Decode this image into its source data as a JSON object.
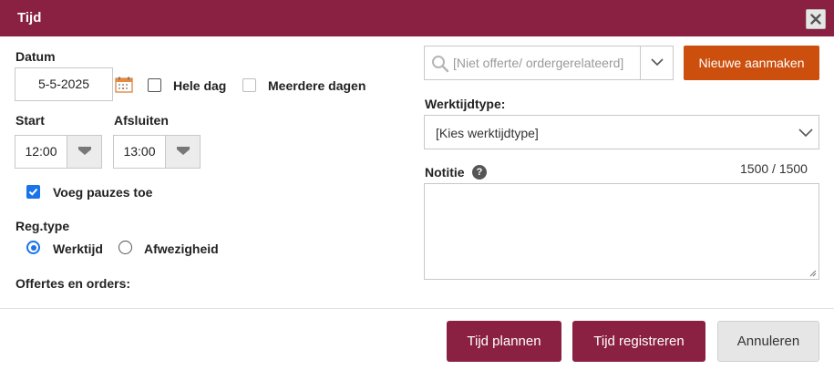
{
  "dialog": {
    "title": "Tijd",
    "close_icon": "close-icon"
  },
  "left": {
    "datum_label": "Datum",
    "date_value": "5-5-2025",
    "calendar_icon": "calendar-icon",
    "hele_dag_label": "Hele dag",
    "hele_dag_checked": false,
    "meerdere_dagen_label": "Meerdere dagen",
    "meerdere_dagen_checked": false,
    "meerdere_dagen_disabled": true,
    "start_label": "Start",
    "start_value": "12:00",
    "afsluiten_label": "Afsluiten",
    "afsluiten_value": "13:00",
    "pauzes_label": "Voeg pauzes toe",
    "pauzes_checked": true,
    "regtype_label": "Reg.type",
    "regtype_options": [
      "Werktijd",
      "Afwezigheid"
    ],
    "regtype_selected": "Werktijd",
    "offertes_label": "Offertes en orders:"
  },
  "right": {
    "search_placeholder": "[Niet offerte/ ordergerelateerd]",
    "search_icon": "search-icon",
    "new_button_label": "Nieuwe aanmaken",
    "werktijdtype_label": "Werktijdtype:",
    "werktijdtype_value": "[Kies werktijdtype]",
    "notitie_label": "Notitie",
    "help_icon": "help-icon",
    "counter": "1500 / 1500"
  },
  "footer": {
    "plan_label": "Tijd plannen",
    "register_label": "Tijd registreren",
    "cancel_label": "Annuleren"
  },
  "colors": {
    "brand": "#8a2042",
    "accent_orange": "#cc4f0d",
    "check_blue": "#1a73e8"
  }
}
